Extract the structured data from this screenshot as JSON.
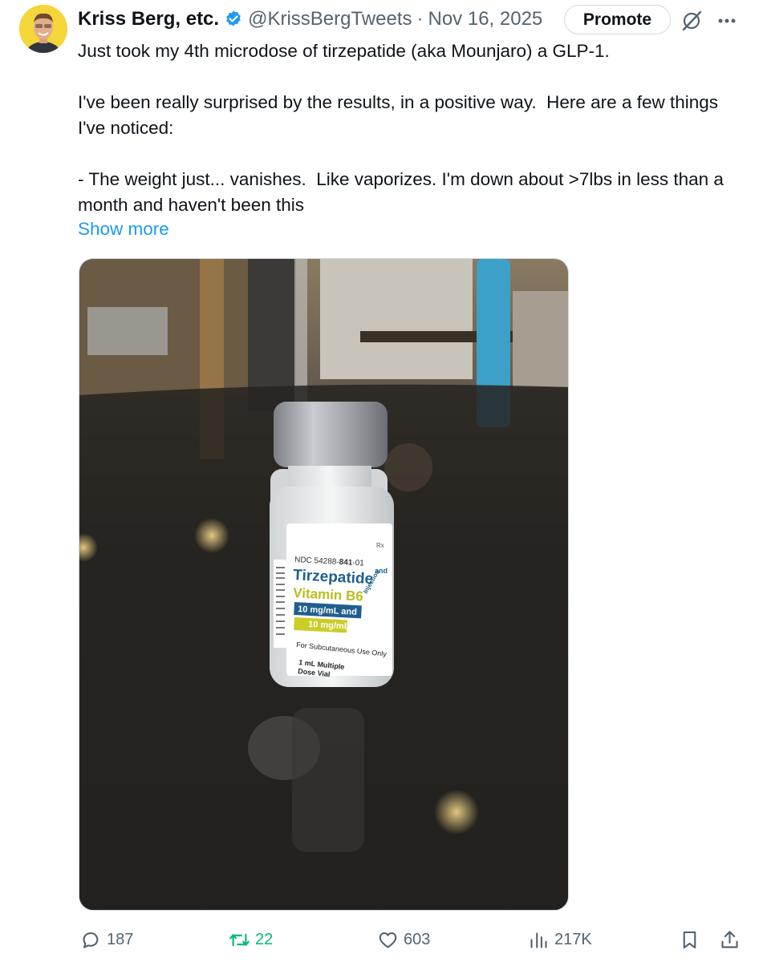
{
  "author": {
    "name": "Kriss Berg, etc.",
    "handle": "@KrissBergTweets",
    "separator": "·",
    "date": "Nov 16, 2025",
    "avatar_icon": "avatar-photo",
    "verified_icon": "verified-badge-icon",
    "verified_color": "#1d9bf0"
  },
  "header_actions": {
    "promote_label": "Promote",
    "grok_icon": "grok-icon",
    "more_icon": "more-icon"
  },
  "tweet": {
    "paragraphs": [
      "Just took my 4th microdose of tirzepatide (aka Mounjaro) a GLP-1.",
      "I've been really surprised by the results, in a positive way.  Here are a few things I've noticed:",
      "- The weight just... vanishes.  Like vaporizes. I'm down about >7lbs in less than a month and haven't been this"
    ],
    "show_more_label": "Show more",
    "link_color": "#1d9bf0"
  },
  "media": {
    "vial_label": {
      "ndc_prefix": "NDC 54288-",
      "ndc_bold": "841",
      "ndc_suffix": "-01",
      "rx": "Rx",
      "drug_name": "Tirzepatide",
      "and_text": "and",
      "vitamin": "Vitamin B6",
      "injection": "Injection",
      "dose1": "10 mg/mL and",
      "dose2": "10 mg/mL",
      "route": "For Subcutaneous Use Only",
      "volume_line1": "1 mL Multiple",
      "volume_line2": "Dose Vial"
    }
  },
  "stats": {
    "replies": "187",
    "retweets": "22",
    "likes": "603",
    "views": "217K",
    "retweet_color": "#00ba7c",
    "icons": [
      "reply-icon",
      "retweet-icon",
      "like-icon",
      "views-icon",
      "bookmark-icon",
      "share-icon"
    ]
  }
}
